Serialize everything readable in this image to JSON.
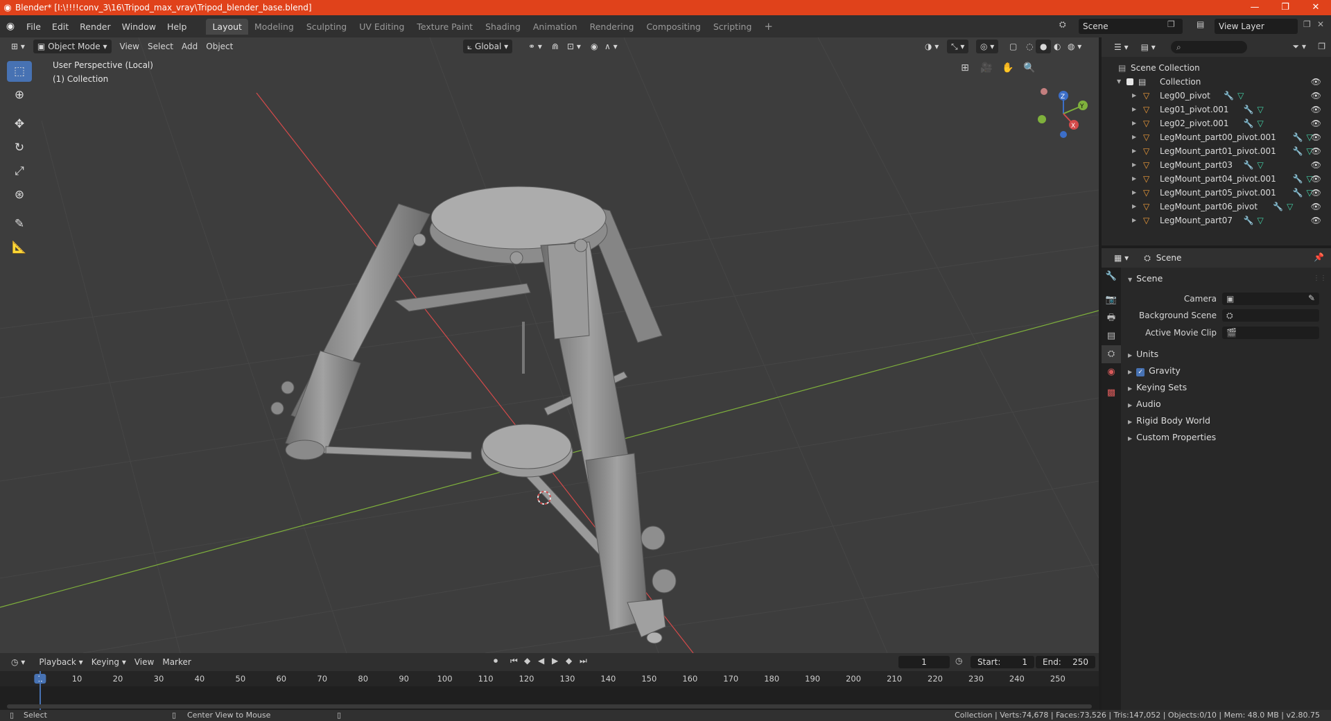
{
  "window": {
    "title": "Blender* [I:\\!!!!conv_3\\16\\Tripod_max_vray\\Tripod_blender_base.blend]",
    "controls": [
      "—",
      "❐",
      "✕"
    ]
  },
  "menu": [
    "File",
    "Edit",
    "Render",
    "Window",
    "Help"
  ],
  "workspaces": [
    "Layout",
    "Modeling",
    "Sculpting",
    "UV Editing",
    "Texture Paint",
    "Shading",
    "Animation",
    "Rendering",
    "Compositing",
    "Scripting"
  ],
  "active_workspace": "Layout",
  "scene_field": "Scene",
  "view_layer_field": "View Layer",
  "viewport": {
    "mode": "Object Mode",
    "menus": [
      "View",
      "Select",
      "Add",
      "Object"
    ],
    "transform_orientation": "Global",
    "overlay_line1": "User Perspective (Local)",
    "overlay_line2": "(1) Collection",
    "gizmo_axes": {
      "z": "Z",
      "y": "Y",
      "x": "X"
    },
    "colors": {
      "x_axis": "#d44a4a",
      "y_axis": "#7fb13c",
      "grid": "#464646",
      "model": "#8f8f8f"
    }
  },
  "timeline": {
    "menus": [
      "Playback",
      "Keying",
      "View",
      "Marker"
    ],
    "current_frame": "1",
    "start_label": "Start:",
    "start": "1",
    "end_label": "End:",
    "end": "250",
    "ticks": [
      "1",
      "10",
      "20",
      "30",
      "40",
      "50",
      "60",
      "70",
      "80",
      "90",
      "100",
      "110",
      "120",
      "130",
      "140",
      "150",
      "160",
      "170",
      "180",
      "190",
      "200",
      "210",
      "220",
      "230",
      "240",
      "250"
    ]
  },
  "status": {
    "left_action": "Select",
    "mid_action": "Center View to Mouse",
    "right": "Collection | Verts:74,678 | Faces:73,526 | Tris:147,052 | Objects:0/10 | Mem: 48.0 MB | v2.80.75"
  },
  "outliner": {
    "root": "Scene Collection",
    "collection": "Collection",
    "objects": [
      {
        "name": "Leg00_pivot"
      },
      {
        "name": "Leg01_pivot.001"
      },
      {
        "name": "Leg02_pivot.001"
      },
      {
        "name": "LegMount_part00_pivot.001"
      },
      {
        "name": "LegMount_part01_pivot.001"
      },
      {
        "name": "LegMount_part03"
      },
      {
        "name": "LegMount_part04_pivot.001"
      },
      {
        "name": "LegMount_part05_pivot.001"
      },
      {
        "name": "LegMount_part06_pivot"
      },
      {
        "name": "LegMount_part07"
      }
    ]
  },
  "properties": {
    "header": "Scene",
    "panel": "Scene",
    "camera_label": "Camera",
    "background_scene_label": "Background Scene",
    "active_movie_clip_label": "Active Movie Clip",
    "subpanels": [
      "Units",
      "Gravity",
      "Keying Sets",
      "Audio",
      "Rigid Body World",
      "Custom Properties"
    ]
  }
}
